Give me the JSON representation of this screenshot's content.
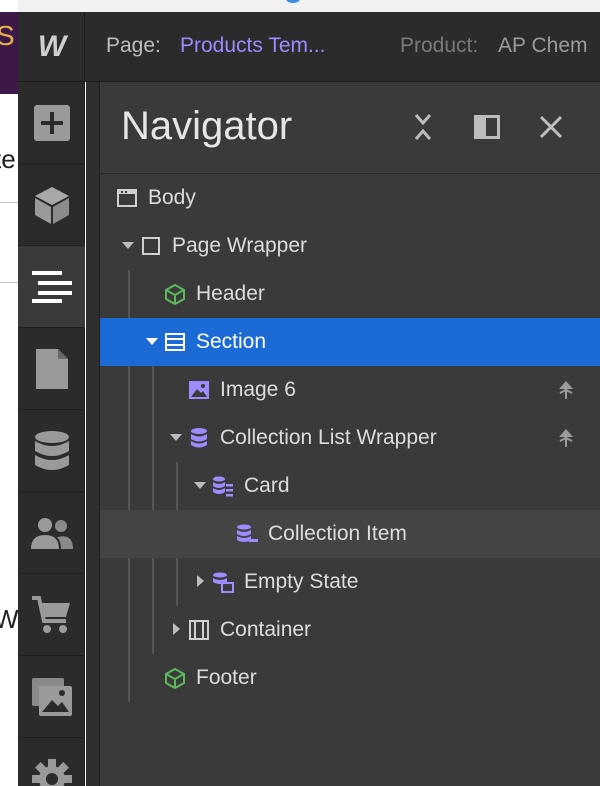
{
  "topbar": {
    "logo_text": "W",
    "page_label": "Page:",
    "page_value": "Products Tem...",
    "product_label": "Product:",
    "product_value": "AP Chem"
  },
  "background_fragments": {
    "frag_1": "te",
    "frag_2": "W"
  },
  "toolbar": {
    "items": [
      {
        "icon": "add-icon"
      },
      {
        "icon": "cube-icon"
      },
      {
        "icon": "navigator-icon",
        "active": true
      },
      {
        "icon": "page-icon"
      },
      {
        "icon": "database-icon"
      },
      {
        "icon": "users-icon"
      },
      {
        "icon": "cart-icon"
      },
      {
        "icon": "assets-icon"
      },
      {
        "icon": "gear-icon"
      }
    ]
  },
  "navigator": {
    "title": "Navigator",
    "tree": [
      {
        "label": "Body",
        "icon": "body-icon"
      },
      {
        "label": "Page Wrapper",
        "icon": "div-block-icon",
        "expanded": true
      },
      {
        "label": "Header",
        "icon": "symbol-icon",
        "icon_color": "#5cb85c"
      },
      {
        "label": "Section",
        "icon": "section-icon",
        "expanded": true,
        "selected": true
      },
      {
        "label": "Image 6",
        "icon": "image-icon",
        "icon_color": "#9d8cff",
        "action_icon": "pin-icon"
      },
      {
        "label": "Collection List Wrapper",
        "icon": "collection-icon",
        "icon_color": "#9d8cff",
        "expanded": true,
        "action_icon": "pin-icon"
      },
      {
        "label": "Card",
        "icon": "collection-list-icon",
        "icon_color": "#9d8cff",
        "expanded": true
      },
      {
        "label": "Collection Item",
        "icon": "collection-item-icon",
        "icon_color": "#9d8cff",
        "hovered": true
      },
      {
        "label": "Empty State",
        "icon": "empty-state-icon",
        "icon_color": "#9d8cff",
        "expanded": false
      },
      {
        "label": "Container",
        "icon": "container-icon",
        "expanded": false
      },
      {
        "label": "Footer",
        "icon": "symbol-icon",
        "icon_color": "#5cb85c"
      }
    ]
  },
  "colors": {
    "accent_selected": "#1b6ad6",
    "page_value": "#9a8cff",
    "symbol_green": "#5cb85c",
    "cms_purple": "#9d8cff"
  }
}
